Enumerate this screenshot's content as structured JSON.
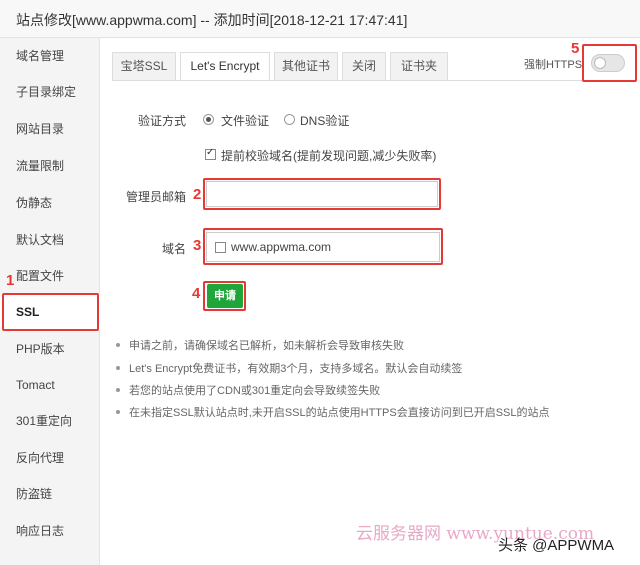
{
  "window": {
    "title": "站点修改[www.appwma.com] -- 添加时间[2018-12-21 17:47:41]"
  },
  "sidebar": {
    "items": [
      {
        "label": "域名管理"
      },
      {
        "label": "子目录绑定"
      },
      {
        "label": "网站目录"
      },
      {
        "label": "流量限制"
      },
      {
        "label": "伪静态"
      },
      {
        "label": "默认文档"
      },
      {
        "label": "配置文件"
      },
      {
        "label": "SSL"
      },
      {
        "label": "PHP版本"
      },
      {
        "label": "Tomact"
      },
      {
        "label": "301重定向"
      },
      {
        "label": "反向代理"
      },
      {
        "label": "防盗链"
      },
      {
        "label": "响应日志"
      }
    ],
    "active_index": 7
  },
  "tabs": [
    {
      "label": "宝塔SSL"
    },
    {
      "label": "Let's Encrypt"
    },
    {
      "label": "其他证书"
    },
    {
      "label": "关闭"
    },
    {
      "label": "证书夹"
    }
  ],
  "force_https": {
    "label": "强制HTTPS",
    "enabled": false
  },
  "form": {
    "verify_method_label": "验证方式",
    "verify_options": [
      {
        "label": "文件验证",
        "checked": true
      },
      {
        "label": "DNS验证",
        "checked": false
      }
    ],
    "precheck": {
      "label": "提前校验域名(提前发现问题,减少失败率)",
      "checked": true
    },
    "admin_email_label": "管理员邮箱",
    "admin_email_value": "",
    "domain_label": "域名",
    "domain_value": "www.appwma.com",
    "domain_checked": false,
    "apply_label": "申请"
  },
  "notes": [
    "申请之前，请确保域名已解析，如未解析会导致审核失败",
    "Let's Encrypt免费证书，有效期3个月，支持多域名。默认会自动续签",
    "若您的站点使用了CDN或301重定向会导致续签失败",
    "在未指定SSL默认站点时,未开启SSL的站点使用HTTPS会直接访问到已开启SSL的站点"
  ],
  "markers": [
    "1",
    "2",
    "3",
    "4",
    "5"
  ],
  "watermark": "云服务器网 www.yuntue.com",
  "credit": "头条 @APPWMA",
  "colors": {
    "accent_green": "#20a53a",
    "annotation_red": "#e53935"
  }
}
